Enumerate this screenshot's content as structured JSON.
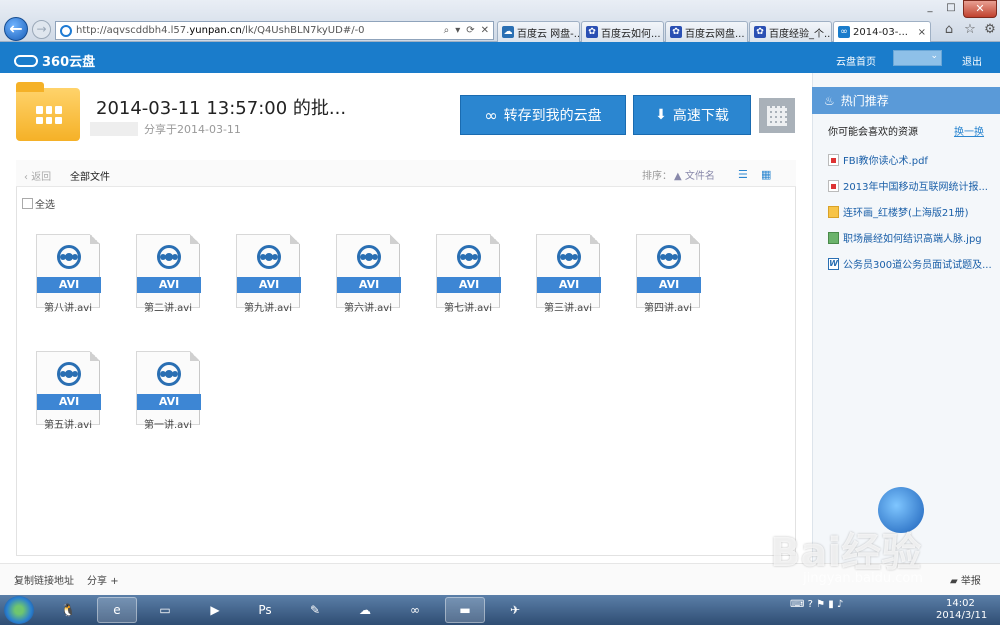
{
  "browser": {
    "url_prefix": "http://aqvscddbh4.l57.",
    "url_host": "yunpan.cn",
    "url_suffix": "/lk/Q4UshBLN7kyUD#/-0",
    "tabs": [
      {
        "label": "百度云 网盘-..."
      },
      {
        "label": "百度云如何..."
      },
      {
        "label": "百度云网盘..."
      },
      {
        "label": "百度经验_个..."
      },
      {
        "label": "2014-03-..."
      }
    ]
  },
  "header": {
    "logo": "360云盘",
    "home_link": "云盘首页",
    "logout": "退出"
  },
  "share": {
    "title": "2014-03-11 13:57:00 的批...",
    "shared_text": "分享于2014-03-11",
    "save_button": "转存到我的云盘",
    "download_button": "高速下载"
  },
  "toolbar": {
    "back": "返回",
    "all_files": "全部文件",
    "sort_label": "排序：",
    "sort_field": "文件名",
    "select_all": "全选"
  },
  "files": [
    {
      "name": "第八讲.avi",
      "type": "AVI"
    },
    {
      "name": "第二讲.avi",
      "type": "AVI"
    },
    {
      "name": "第九讲.avi",
      "type": "AVI"
    },
    {
      "name": "第六讲.avi",
      "type": "AVI"
    },
    {
      "name": "第七讲.avi",
      "type": "AVI"
    },
    {
      "name": "第三讲.avi",
      "type": "AVI"
    },
    {
      "name": "第四讲.avi",
      "type": "AVI"
    },
    {
      "name": "第五讲.avi",
      "type": "AVI"
    },
    {
      "name": "第一讲.avi",
      "type": "AVI"
    }
  ],
  "sidebar": {
    "title": "热门推荐",
    "subtitle": "你可能会喜欢的资源",
    "more": "换一换",
    "items": [
      {
        "label": "FBI教你读心术.pdf",
        "icon": "pdf-icon"
      },
      {
        "label": "2013年中国移动互联网统计报...",
        "icon": "pdf-icon"
      },
      {
        "label": "连环画_红楼梦(上海版21册)",
        "icon": "folder-icon"
      },
      {
        "label": "职场晨经如何结识高端人脉.jpg",
        "icon": "image-icon"
      },
      {
        "label": "公务员300道公务员面试试题及...",
        "icon": "word-icon"
      }
    ]
  },
  "footer": {
    "copy_link": "复制链接地址",
    "share": "分享",
    "report": "举报"
  },
  "watermark": {
    "brand": "Bai经验",
    "url": "jingyan.baidu.com"
  },
  "taskbar": {
    "time": "14:02",
    "date": "2014/3/11"
  }
}
